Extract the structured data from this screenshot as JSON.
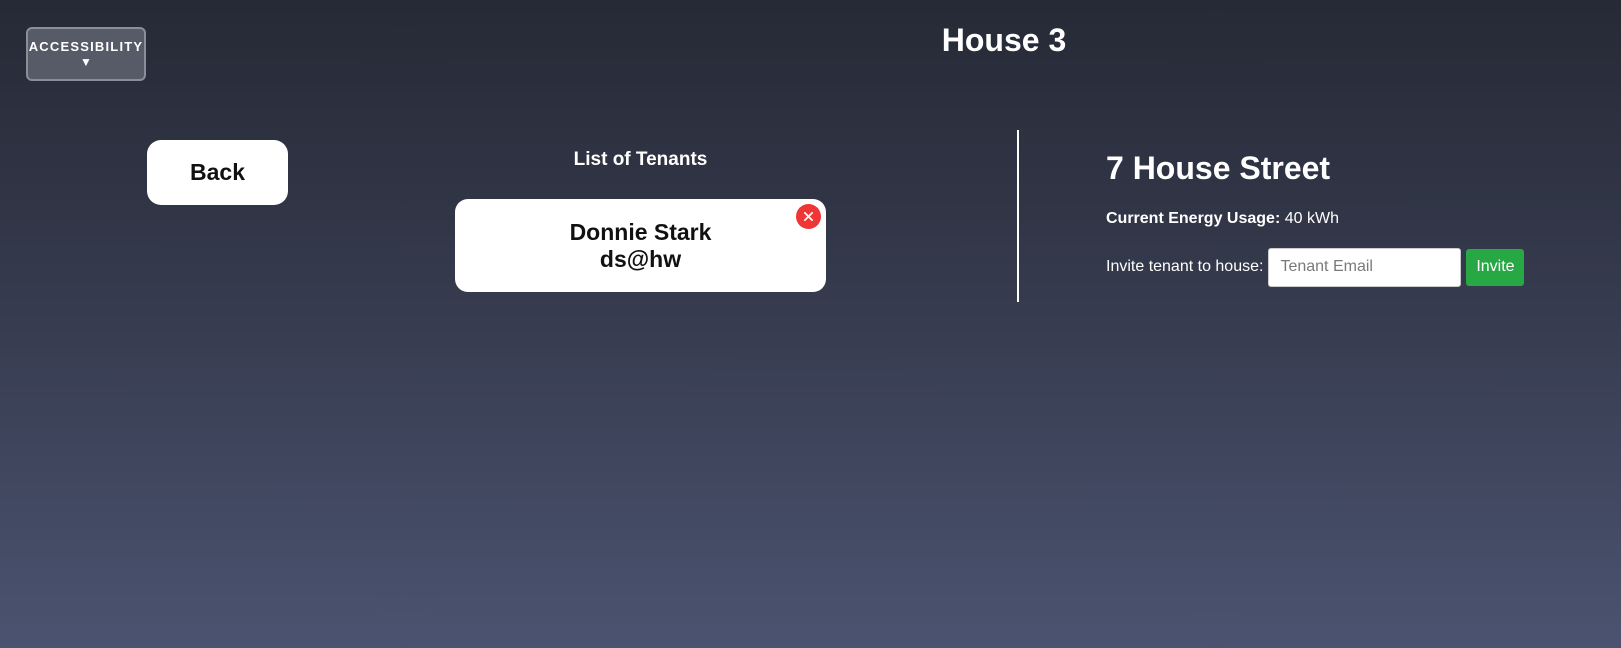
{
  "accessibility": {
    "label": "ACCESSIBILITY",
    "arrow": "▼"
  },
  "page": {
    "title": "House 3"
  },
  "nav": {
    "back_label": "Back"
  },
  "tenants": {
    "heading": "List of Tenants",
    "items": [
      {
        "name": "Donnie Stark",
        "email": "ds@hw",
        "remove_icon": "close-icon"
      }
    ]
  },
  "house": {
    "address": "7 House Street",
    "energy_label": "Current Energy Usage:",
    "energy_value": "40 kWh",
    "invite_label": "Invite tenant to house:",
    "invite_placeholder": "Tenant Email",
    "invite_value": "",
    "invite_button_label": "Invite"
  },
  "colors": {
    "background_top": "#262a36",
    "background_bottom": "#4b5370",
    "invite_button": "#28a745",
    "remove_button": "#ef3535",
    "card": "#ffffff"
  }
}
